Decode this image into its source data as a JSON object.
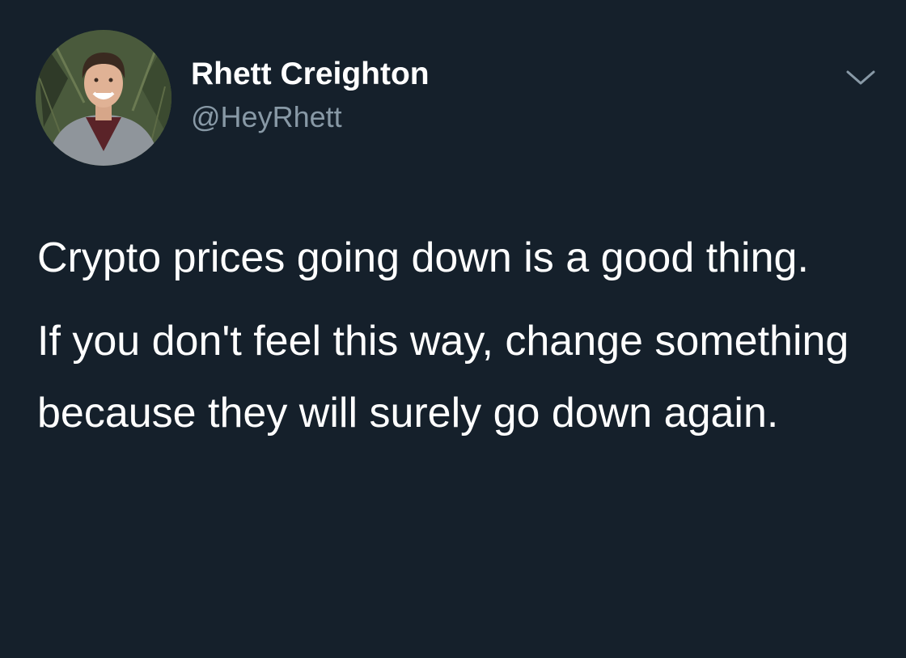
{
  "tweet": {
    "author": {
      "display_name": "Rhett Creighton",
      "handle": "@HeyRhett",
      "avatar_icon": "avatar-photo"
    },
    "menu_icon": "chevron-down-icon",
    "paragraphs": [
      "Crypto prices going down is a good thing.",
      "If you don't feel this way, change something because they will surely go down again."
    ]
  },
  "colors": {
    "background": "#15202b",
    "text_primary": "#ffffff",
    "text_secondary": "#8899a6"
  }
}
